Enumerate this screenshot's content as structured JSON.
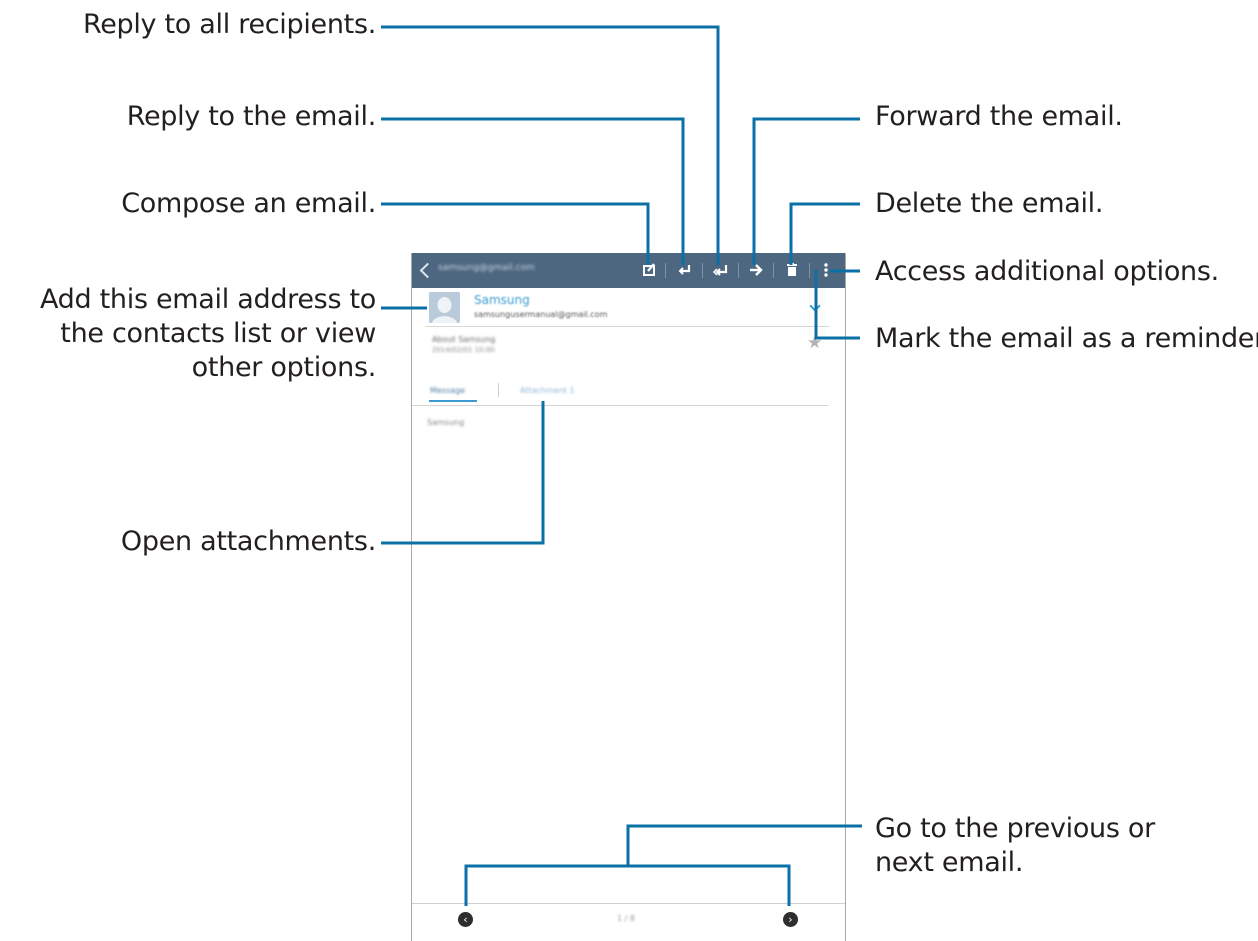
{
  "callouts": {
    "reply_all": "Reply to all recipients.",
    "reply": "Reply to the email.",
    "compose": "Compose an email.",
    "add_contact": "Add this email address to the contacts list or view other options.",
    "open_attachments": "Open attachments.",
    "forward": "Forward the email.",
    "delete": "Delete the email.",
    "more_options": "Access additional options.",
    "reminder": "Mark the email as a reminder.",
    "prev_next": "Go to the previous or next email."
  },
  "colors": {
    "callout_line": "#0a70a6",
    "action_bar": "#4d6780",
    "accent": "#3a9ad1"
  },
  "screen": {
    "action_bar": {
      "back_icon": "chevron-left-icon",
      "icons": [
        "compose-icon",
        "reply-icon",
        "reply-all-icon",
        "forward-icon",
        "delete-icon",
        "more-options-icon"
      ]
    },
    "sender": {
      "name": "Samsung"
    },
    "star_icon": "star-icon",
    "nav": {
      "prev_icon": "chevron-left-circle-icon",
      "next_icon": "chevron-right-circle-icon"
    }
  }
}
